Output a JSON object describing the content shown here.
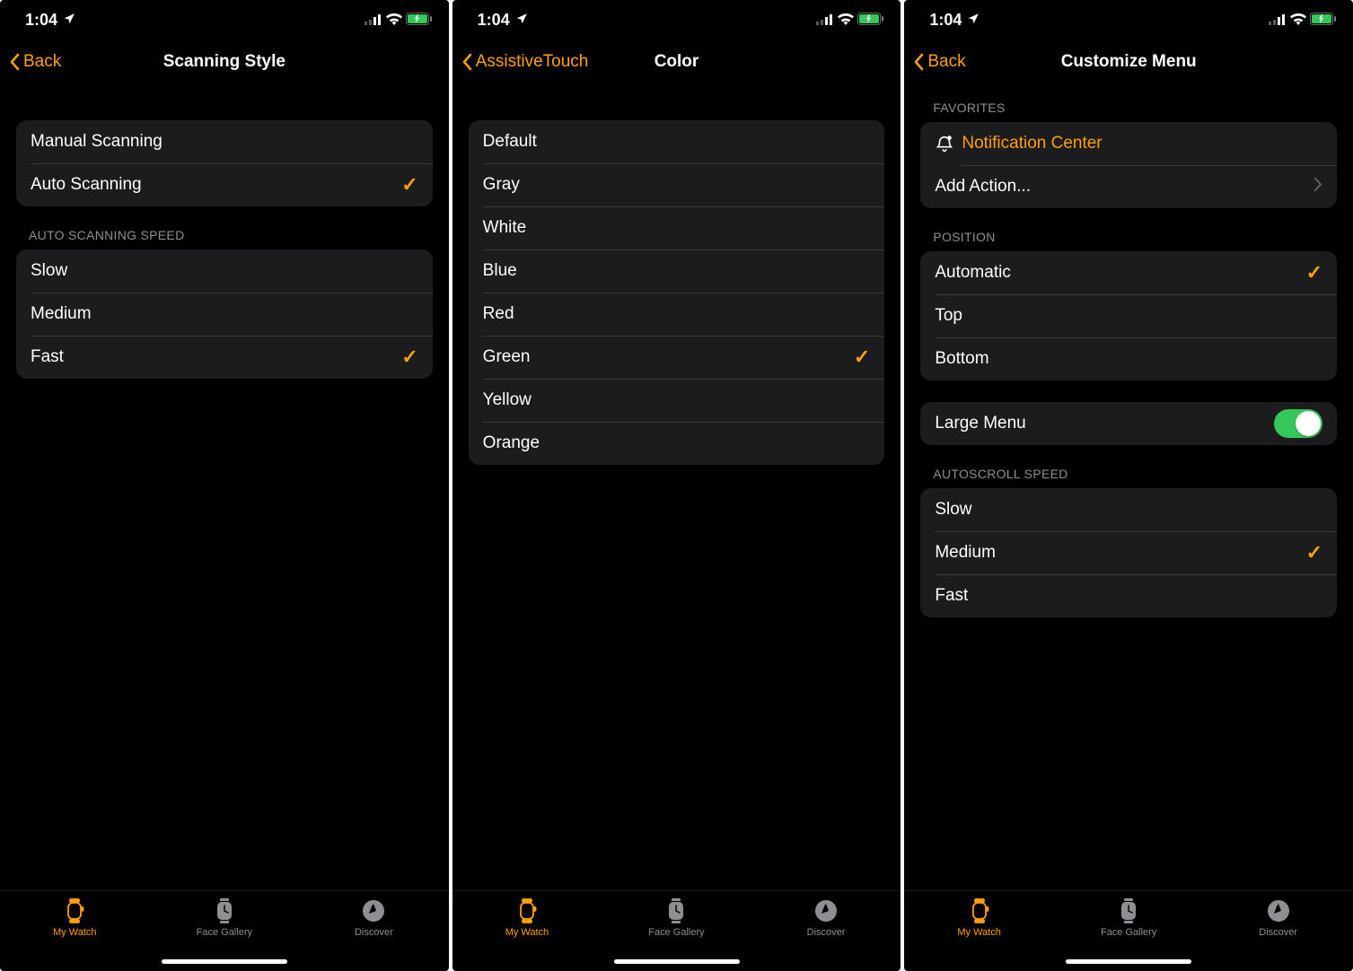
{
  "status": {
    "time": "1:04"
  },
  "tabs": {
    "my_watch": "My Watch",
    "face_gallery": "Face Gallery",
    "discover": "Discover"
  },
  "screen1": {
    "back_label": "Back",
    "title": "Scanning Style",
    "group1": {
      "items": [
        {
          "label": "Manual Scanning",
          "selected": false
        },
        {
          "label": "Auto Scanning",
          "selected": true
        }
      ]
    },
    "speed_header": "AUTO SCANNING SPEED",
    "speed": {
      "items": [
        {
          "label": "Slow",
          "selected": false
        },
        {
          "label": "Medium",
          "selected": false
        },
        {
          "label": "Fast",
          "selected": true
        }
      ]
    }
  },
  "screen2": {
    "back_label": "AssistiveTouch",
    "title": "Color",
    "colors": {
      "items": [
        {
          "label": "Default",
          "selected": false
        },
        {
          "label": "Gray",
          "selected": false
        },
        {
          "label": "White",
          "selected": false
        },
        {
          "label": "Blue",
          "selected": false
        },
        {
          "label": "Red",
          "selected": false
        },
        {
          "label": "Green",
          "selected": true
        },
        {
          "label": "Yellow",
          "selected": false
        },
        {
          "label": "Orange",
          "selected": false
        }
      ]
    }
  },
  "screen3": {
    "back_label": "Back",
    "title": "Customize Menu",
    "favorites_header": "FAVORITES",
    "favorites": {
      "notification_label": "Notification Center",
      "add_action_label": "Add Action..."
    },
    "position_header": "POSITION",
    "position": {
      "items": [
        {
          "label": "Automatic",
          "selected": true
        },
        {
          "label": "Top",
          "selected": false
        },
        {
          "label": "Bottom",
          "selected": false
        }
      ]
    },
    "large_menu_label": "Large Menu",
    "large_menu_on": true,
    "autoscroll_header": "AUTOSCROLL SPEED",
    "autoscroll": {
      "items": [
        {
          "label": "Slow",
          "selected": false
        },
        {
          "label": "Medium",
          "selected": true
        },
        {
          "label": "Fast",
          "selected": false
        }
      ]
    }
  }
}
